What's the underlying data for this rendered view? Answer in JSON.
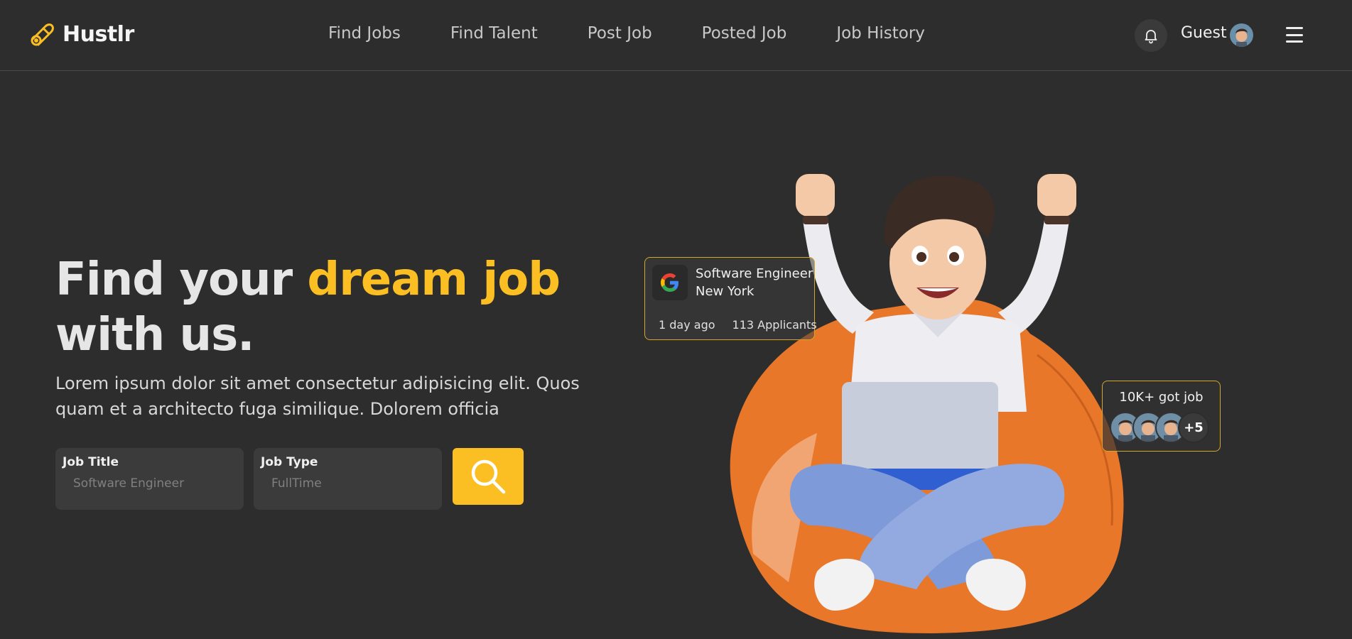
{
  "header": {
    "brand": "Hustlr",
    "nav": [
      "Find Jobs",
      "Find Talent",
      "Post Job",
      "Posted Job",
      "Job History"
    ],
    "user_name": "Guest"
  },
  "hero": {
    "title_start": "Find your ",
    "title_highlight": "dream job",
    "title_end": " with us.",
    "description": "Lorem ipsum dolor sit amet consectetur adipisicing elit. Quos quam et a architecto fuga similique. Dolorem officia"
  },
  "search": {
    "job_title_label": "Job Title",
    "job_title_placeholder": "Software Engineer",
    "job_type_label": "Job Type",
    "job_type_placeholder": "FullTime"
  },
  "job_card": {
    "title": "Software Engineer",
    "location": "New York",
    "posted": "1 day ago",
    "applicants": "113 Applicants"
  },
  "got_job_card": {
    "label": "10K+ got job",
    "extra": "+5"
  },
  "colors": {
    "background": "#2d2d2d",
    "accent": "#fbbf24"
  }
}
